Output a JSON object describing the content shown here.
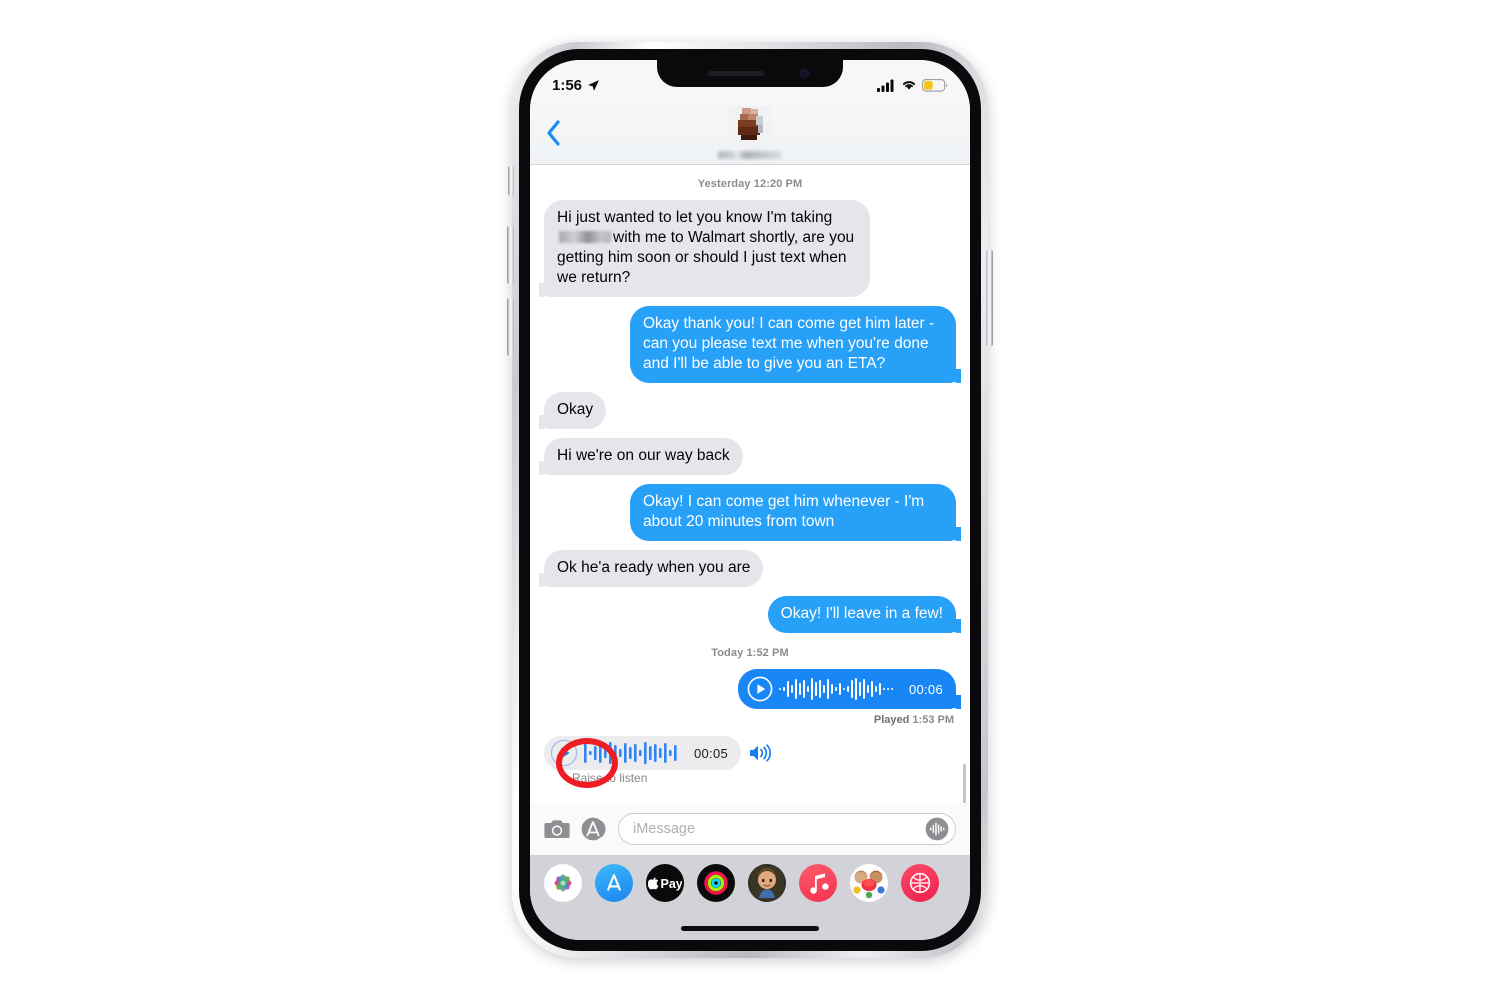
{
  "device": {
    "type": "iphone-x",
    "frame_color": "#c9c9cf"
  },
  "status_bar": {
    "time": "1:56",
    "location_icon": "location-arrow-icon",
    "cellular_icon": "cellular-bars-icon",
    "wifi_icon": "wifi-icon",
    "battery_icon": "battery-low-power-icon",
    "battery_color": "#f5c518"
  },
  "chat_header": {
    "back_icon": "back-chevron-icon",
    "back_color": "#1a8cf5",
    "avatar": "contact-avatar-redacted",
    "contact_name": "",
    "contact_name_redacted": true
  },
  "conversation": {
    "day_stamp_1": "Yesterday 12:20 PM",
    "day_stamp_2": "Today 1:52 PM",
    "messages": [
      {
        "direction": "in",
        "text_before": "Hi just wanted to let you know I'm taking",
        "redacted": true,
        "text_after": "with me to Walmart shortly, are you getting him soon or should I just text when we return?"
      },
      {
        "direction": "out",
        "text": "Okay thank you! I can come get him later - can you please text me when you're done and I'll be able to give you an ETA?"
      },
      {
        "direction": "in",
        "text": "Okay"
      },
      {
        "direction": "in",
        "text": "Hi we're on our way back"
      },
      {
        "direction": "out",
        "text": "Okay! I can come get him whenever - I'm about 20 minutes from town"
      },
      {
        "direction": "in",
        "text": "Ok he'a ready when you are"
      },
      {
        "direction": "out",
        "text": "Okay! I'll leave in a few!"
      }
    ],
    "audio_sent": {
      "play_icon": "play-icon",
      "waveform_icon": "audio-waveform-icon",
      "duration": "00:06",
      "status": "Played 1:53 PM",
      "status_label": "Played",
      "status_time": "1:53 PM",
      "bubble_color": "#1886f5"
    },
    "audio_received": {
      "play_icon": "play-icon",
      "waveform_icon": "audio-waveform-icon",
      "duration": "00:05",
      "speaker_icon": "speaker-volume-icon",
      "hint": "Raise to listen",
      "pill_color": "#ececef",
      "accent_color": "#1a7cf0"
    }
  },
  "annotation": {
    "highlight_shape": "circle",
    "highlight_color": "#ee1d23",
    "target": "received-audio-play-button"
  },
  "input_bar": {
    "camera_icon": "camera-icon",
    "appstore_icon": "app-store-icon",
    "placeholder": "iMessage",
    "value": "",
    "audio_record_icon": "audio-record-waveform-icon"
  },
  "app_drawer": {
    "apps": [
      {
        "name": "photos-app-icon",
        "label": "Photos"
      },
      {
        "name": "app-store-app-icon",
        "label": "App Store"
      },
      {
        "name": "apple-pay-app-icon",
        "label": "Apple Pay"
      },
      {
        "name": "activity-rings-app-icon",
        "label": "Activity"
      },
      {
        "name": "memoji-app-icon",
        "label": "Memoji"
      },
      {
        "name": "music-app-icon",
        "label": "Music"
      },
      {
        "name": "memoji-stickers-app-icon",
        "label": "Memoji Stickers"
      },
      {
        "name": "partial-red-app-icon",
        "label": ""
      }
    ]
  },
  "home_indicator": {
    "name": "home-indicator"
  }
}
